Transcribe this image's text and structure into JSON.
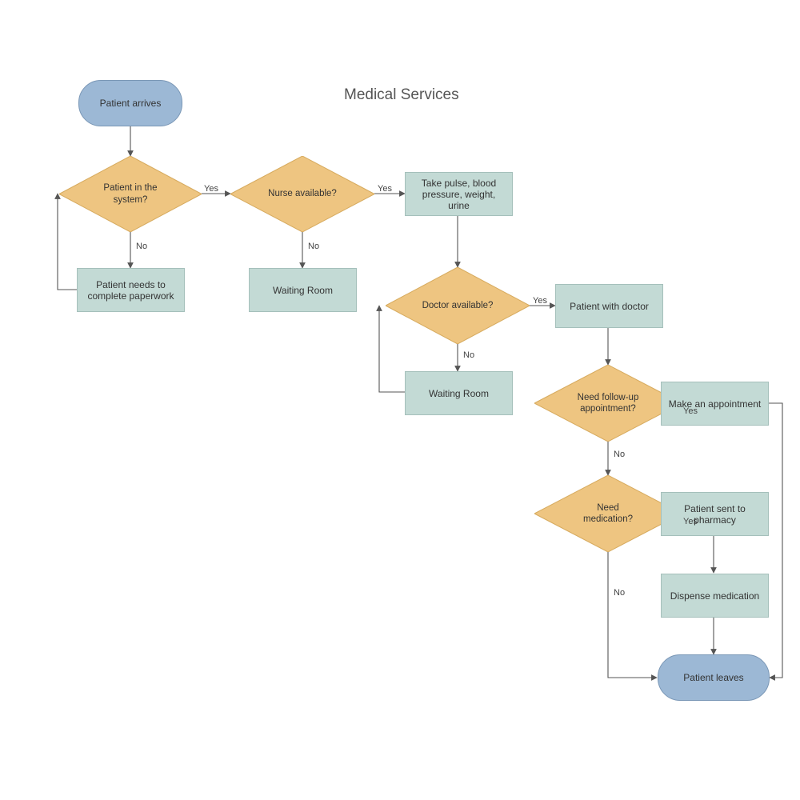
{
  "title": "Medical Services",
  "nodes": {
    "start": "Patient arrives",
    "d1": "Patient in the system?",
    "paperwork": "Patient needs to complete paperwork",
    "d2": "Nurse available?",
    "wait1": "Waiting Room",
    "vitals": "Take pulse, blood pressure, weight, urine",
    "d3": "Doctor available?",
    "wait2": "Waiting Room",
    "withdoctor": "Patient with doctor",
    "d4": "Need follow-up appointment?",
    "appt": "Make an appointment",
    "d5": "Need medication?",
    "pharmacy": "Patient sent to pharmacy",
    "dispense": "Dispense medication",
    "end": "Patient leaves"
  },
  "labels": {
    "yes": "Yes",
    "no": "No"
  },
  "colors": {
    "terminator": "#9cb8d5",
    "terminatorBorder": "#7a97b6",
    "process": "#c3dad5",
    "processBorder": "#a5c0bb",
    "decision": "#eec581",
    "decisionBorder": "#d7ab5f",
    "line": "#555"
  }
}
